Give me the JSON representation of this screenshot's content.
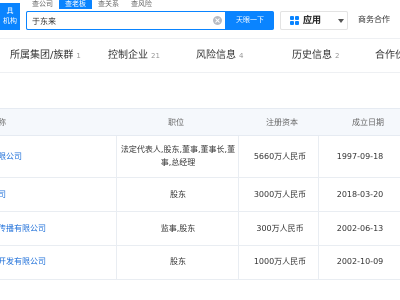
{
  "header": {
    "logo_lines": [
      "具",
      "机构"
    ],
    "search_tabs": [
      "查公司",
      "查老板",
      "查关系",
      "查风险"
    ],
    "active_search_tab": 1,
    "search_value": "于东来",
    "search_button": "天眼一下",
    "app_button": "应用",
    "business_link": "商务合作"
  },
  "category_tabs": [
    {
      "label": "所属集团/族群",
      "count": "1"
    },
    {
      "label": "控制企业",
      "count": "21"
    },
    {
      "label": "风险信息",
      "count": "4"
    },
    {
      "label": "历史信息",
      "count": "2"
    },
    {
      "label": "合作伙",
      "count": ""
    }
  ],
  "table": {
    "headers": {
      "name": "称",
      "position": "职位",
      "capital": "注册资本",
      "date": "成立日期"
    },
    "rows": [
      {
        "name": "限公司",
        "position": "法定代表人,股东,董事,董事长,董事,总经理",
        "capital": "5660万人民币",
        "date": "1997-09-18"
      },
      {
        "name": "司",
        "position": "股东",
        "capital": "3000万人民币",
        "date": "2018-03-20"
      },
      {
        "name": "传播有限公司",
        "position": "监事,股东",
        "capital": "300万人民币",
        "date": "2002-06-13"
      },
      {
        "name": "开发有限公司",
        "position": "股东",
        "capital": "1000万人民币",
        "date": "2002-10-09"
      }
    ]
  },
  "colors": {
    "accent": "#0a84ff",
    "link": "#1e6fd9"
  }
}
